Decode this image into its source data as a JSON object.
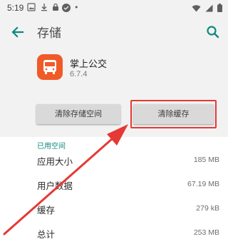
{
  "status_bar": {
    "time": "5:19"
  },
  "app_bar": {
    "title": "存储"
  },
  "app_info": {
    "name": "掌上公交",
    "version": "6.7.4",
    "icon_color": "#f05a28"
  },
  "buttons": {
    "clear_storage": "清除存储空间",
    "clear_cache": "清除缓存"
  },
  "storage": {
    "section_title": "已用空间",
    "rows": [
      {
        "label": "应用大小",
        "value": "185 MB"
      },
      {
        "label": "用户数据",
        "value": "67.19 MB"
      },
      {
        "label": "缓存",
        "value": "279 kB"
      },
      {
        "label": "总计",
        "value": "253 MB"
      }
    ]
  },
  "colors": {
    "accent": "#0d8a7d",
    "annotation": "#e53935"
  }
}
